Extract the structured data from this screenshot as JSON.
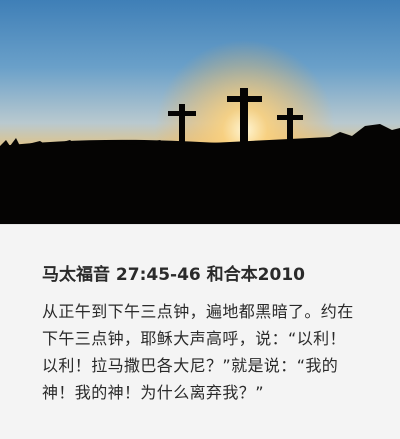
{
  "hero": {
    "image_description": "Three crosses silhouetted against a sunset sky over a dark hillside",
    "colors": {
      "sky_top": "#3f7fb7",
      "horizon": "#f4a63a",
      "ground": "#000000"
    }
  },
  "verse_card": {
    "reference": "马太福音 27:45-46 和合本2010",
    "text": "从正午到下午三点钟，遍地都黑暗了。约在下午三点钟，耶稣大声高呼，说：“以利！以利！拉马撒巴各大尼？”就是说：“我的神！我的神！为什么离弃我？”"
  }
}
